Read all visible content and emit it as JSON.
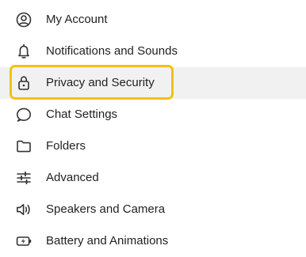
{
  "menu": {
    "items": [
      {
        "label": "My Account",
        "icon": "account-icon"
      },
      {
        "label": "Notifications and Sounds",
        "icon": "bell-icon"
      },
      {
        "label": "Privacy and Security",
        "icon": "lock-icon",
        "selected": true
      },
      {
        "label": "Chat Settings",
        "icon": "chat-bubble-icon"
      },
      {
        "label": "Folders",
        "icon": "folder-icon"
      },
      {
        "label": "Advanced",
        "icon": "sliders-icon"
      },
      {
        "label": "Speakers and Camera",
        "icon": "speaker-icon"
      },
      {
        "label": "Battery and Animations",
        "icon": "battery-icon"
      }
    ]
  },
  "colors": {
    "highlight_border": "#f4c015",
    "selected_background": "#f1f1f1",
    "text": "#222222",
    "icon": "#333333"
  }
}
